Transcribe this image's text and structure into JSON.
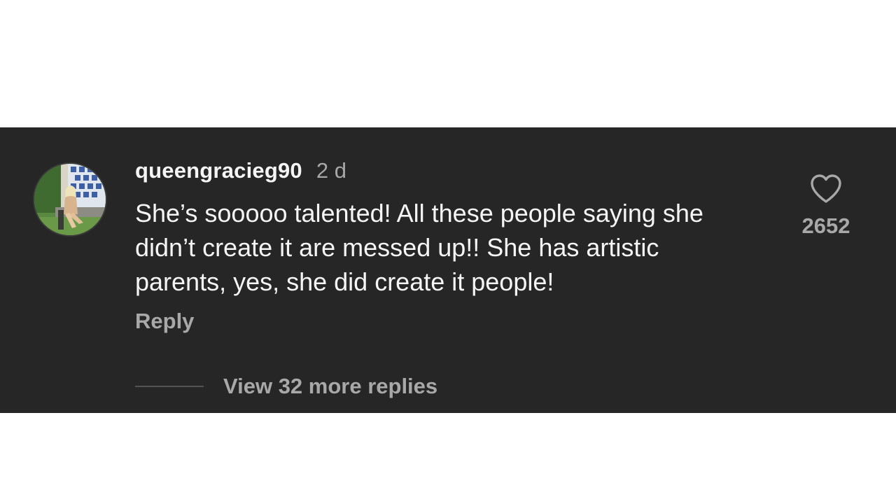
{
  "comment": {
    "username": "queengracieg90",
    "timestamp": "2 d",
    "text": "She’s sooooo talented! All these people saying she didn’t create it are messed up!! She has artistic parents, yes, she did create it people!",
    "reply_label": "Reply",
    "like_count": "2652",
    "like_icon": "heart-outline-icon",
    "view_replies_label": "View 32 more replies"
  },
  "colors": {
    "panel_background": "#262626",
    "primary_text": "#f5f5f5",
    "secondary_text": "#a8a8a8",
    "page_background": "#ffffff"
  }
}
